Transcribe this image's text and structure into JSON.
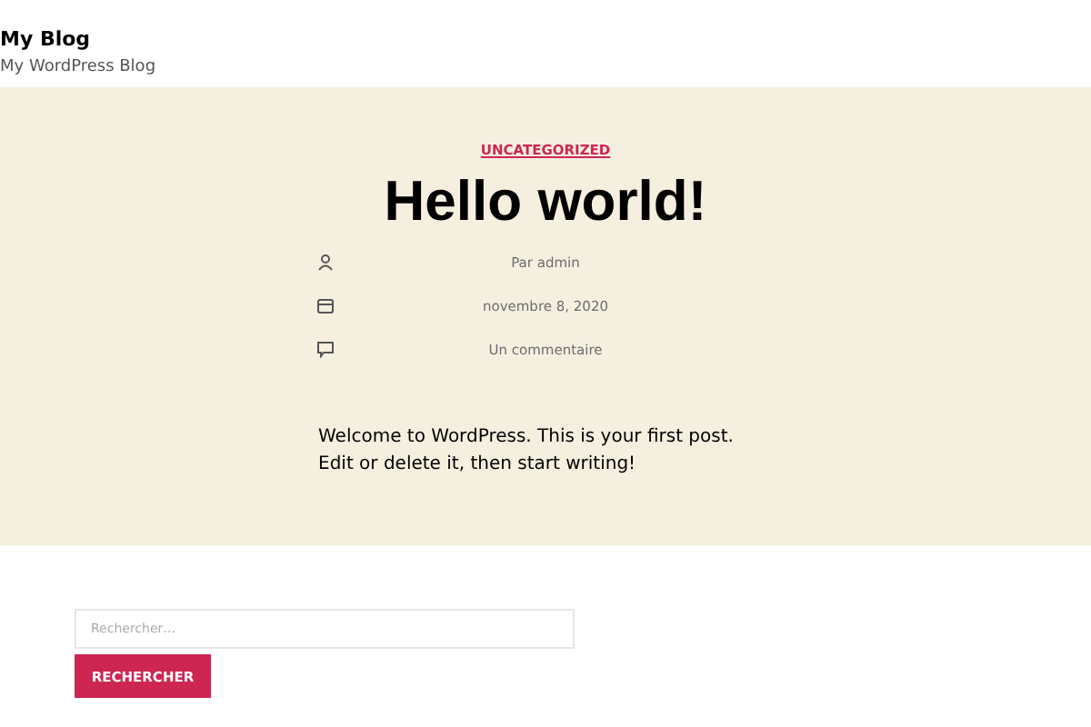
{
  "site": {
    "title": "My Blog",
    "tagline": "My WordPress Blog"
  },
  "post": {
    "category": "UNCATEGORIZED",
    "title": "Hello world!",
    "meta": [
      {
        "kind": "author",
        "text": "Par admin"
      },
      {
        "kind": "date",
        "text": "novembre 8, 2020"
      },
      {
        "kind": "comments",
        "text": "Un commentaire"
      }
    ],
    "body": "Welcome to WordPress. This is your first post. Edit or delete it, then start writing!"
  },
  "search": {
    "placeholder": "Rechercher…",
    "button": "RECHERCHER"
  }
}
